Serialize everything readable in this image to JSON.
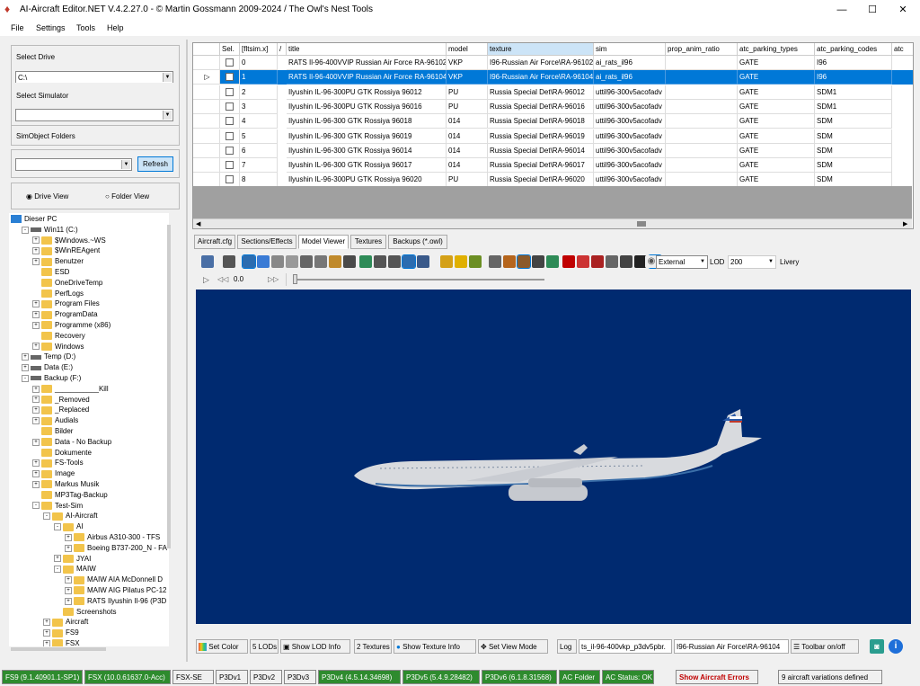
{
  "window": {
    "title": "AI-Aircraft Editor.NET V.4.2.27.0  -  © Martin Gossmann 2009-2024 / The Owl's Nest Tools"
  },
  "menu": [
    "File",
    "Settings",
    "Tools",
    "Help"
  ],
  "left": {
    "select_drive_label": "Select Drive",
    "drive_value": "C:\\",
    "select_sim_label": "Select Simulator",
    "sim_value": "",
    "simobj_label": "SimObject Folders",
    "simobj_value": "",
    "refresh": "Refresh",
    "drive_view": "Drive View",
    "folder_view": "Folder View"
  },
  "tree": [
    {
      "t": "Dieser PC",
      "d": 0,
      "k": "pc"
    },
    {
      "t": "Win11 (C:)",
      "d": 1,
      "k": "drive",
      "pm": "-"
    },
    {
      "t": "$Windows.~WS",
      "d": 2,
      "k": "folder",
      "pm": "+"
    },
    {
      "t": "$WinREAgent",
      "d": 2,
      "k": "folder",
      "pm": "+"
    },
    {
      "t": "Benutzer",
      "d": 2,
      "k": "folder",
      "pm": "+"
    },
    {
      "t": "ESD",
      "d": 2,
      "k": "folder"
    },
    {
      "t": "OneDriveTemp",
      "d": 2,
      "k": "folder"
    },
    {
      "t": "PerfLogs",
      "d": 2,
      "k": "folder"
    },
    {
      "t": "Program Files",
      "d": 2,
      "k": "folder",
      "pm": "+"
    },
    {
      "t": "ProgramData",
      "d": 2,
      "k": "folder",
      "pm": "+"
    },
    {
      "t": "Programme (x86)",
      "d": 2,
      "k": "folder",
      "pm": "+"
    },
    {
      "t": "Recovery",
      "d": 2,
      "k": "folder"
    },
    {
      "t": "Windows",
      "d": 2,
      "k": "folder",
      "pm": "+"
    },
    {
      "t": "Temp (D:)",
      "d": 1,
      "k": "drive",
      "pm": "+"
    },
    {
      "t": "Data (E:)",
      "d": 1,
      "k": "drive",
      "pm": "+"
    },
    {
      "t": "Backup (F:)",
      "d": 1,
      "k": "drive",
      "pm": "-"
    },
    {
      "t": "___________Kill",
      "d": 2,
      "k": "folder",
      "pm": "+"
    },
    {
      "t": "_Removed",
      "d": 2,
      "k": "folder",
      "pm": "+"
    },
    {
      "t": "_Replaced",
      "d": 2,
      "k": "folder",
      "pm": "+"
    },
    {
      "t": "Audials",
      "d": 2,
      "k": "folder",
      "pm": "+"
    },
    {
      "t": "Bilder",
      "d": 2,
      "k": "folder"
    },
    {
      "t": "Data - No Backup",
      "d": 2,
      "k": "folder",
      "pm": "+"
    },
    {
      "t": "Dokumente",
      "d": 2,
      "k": "folder"
    },
    {
      "t": "FS-Tools",
      "d": 2,
      "k": "folder",
      "pm": "+"
    },
    {
      "t": "Image",
      "d": 2,
      "k": "folder",
      "pm": "+"
    },
    {
      "t": "Markus Musik",
      "d": 2,
      "k": "folder",
      "pm": "+"
    },
    {
      "t": "MP3Tag-Backup",
      "d": 2,
      "k": "folder"
    },
    {
      "t": "Test-Sim",
      "d": 2,
      "k": "folder",
      "pm": "-"
    },
    {
      "t": "AI-Aircraft",
      "d": 3,
      "k": "folder",
      "pm": "-"
    },
    {
      "t": "AI",
      "d": 4,
      "k": "folder",
      "pm": "-"
    },
    {
      "t": "Airbus A310-300 - TFS",
      "d": 5,
      "k": "folder",
      "pm": "+"
    },
    {
      "t": "Boeing B737-200_N - FA",
      "d": 5,
      "k": "folder",
      "pm": "+"
    },
    {
      "t": "JYAI",
      "d": 4,
      "k": "folder",
      "pm": "+"
    },
    {
      "t": "MAIW",
      "d": 4,
      "k": "folder",
      "pm": "-"
    },
    {
      "t": "MAIW AIA McDonnell D",
      "d": 5,
      "k": "folder",
      "pm": "+"
    },
    {
      "t": "MAIW AIG Pilatus PC-12",
      "d": 5,
      "k": "folder",
      "pm": "+"
    },
    {
      "t": "RATS Ilyushin Il-96 (P3D",
      "d": 5,
      "k": "folder",
      "pm": "+"
    },
    {
      "t": "Screenshots",
      "d": 4,
      "k": "folder"
    },
    {
      "t": "Aircraft",
      "d": 3,
      "k": "folder",
      "pm": "+"
    },
    {
      "t": "FS9",
      "d": 3,
      "k": "folder",
      "pm": "+"
    },
    {
      "t": "FSX",
      "d": 3,
      "k": "folder",
      "pm": "+"
    }
  ],
  "grid": {
    "headers": [
      "Sel.",
      "[fltsim.x]",
      "/",
      "title",
      "model",
      "texture",
      "sim",
      "prop_anim_ratio",
      "atc_parking_types",
      "atc_parking_codes",
      "atc"
    ],
    "rows": [
      [
        "0",
        "RATS Il-96-400VVIP Russian Air Force RA-96102",
        "VKP",
        "I96-Russian Air Force\\RA-96102",
        "ai_rats_il96",
        "",
        "GATE",
        "I96"
      ],
      [
        "1",
        "RATS Il-96-400VVIP Russian Air Force RA-96104",
        "VKP",
        "I96-Russian Air Force\\RA-96104",
        "ai_rats_il96",
        "",
        "GATE",
        "I96"
      ],
      [
        "2",
        "Ilyushin IL-96-300PU GTK Rossiya 96012",
        "PU",
        "Russia Special Det\\RA-96012",
        "uttil96-300v5acofadv",
        "",
        "GATE",
        "SDM1"
      ],
      [
        "3",
        "Ilyushin IL-96-300PU GTK Rossiya 96016",
        "PU",
        "Russia Special Det\\RA-96016",
        "uttil96-300v5acofadv",
        "",
        "GATE",
        "SDM1"
      ],
      [
        "4",
        "Ilyushin IL-96-300 GTK Rossiya 96018",
        "014",
        "Russia Special Det\\RA-96018",
        "uttil96-300v5acofadv",
        "",
        "GATE",
        "SDM"
      ],
      [
        "5",
        "Ilyushin IL-96-300 GTK Rossiya 96019",
        "014",
        "Russia Special Det\\RA-96019",
        "uttil96-300v5acofadv",
        "",
        "GATE",
        "SDM"
      ],
      [
        "6",
        "Ilyushin IL-96-300 GTK Rossiya 96014",
        "014",
        "Russia Special Det\\RA-96014",
        "uttil96-300v5acofadv",
        "",
        "GATE",
        "SDM"
      ],
      [
        "7",
        "Ilyushin IL-96-300 GTK Rossiya 96017",
        "014",
        "Russia Special Det\\RA-96017",
        "uttil96-300v5acofadv",
        "",
        "GATE",
        "SDM"
      ],
      [
        "8",
        "Ilyushin IL-96-300PU GTK Rossiya 96020",
        "PU",
        "Russia Special Det\\RA-96020",
        "uttil96-300v5acofadv",
        "",
        "GATE",
        "SDM"
      ]
    ],
    "selected_row": 1
  },
  "tabs": [
    "Aircraft.cfg",
    "Sections/Effects",
    "Model Viewer",
    "Textures",
    "Backups (*.owl)"
  ],
  "active_tab": 2,
  "viewer": {
    "view_mode": "External",
    "lod_label": "LOD",
    "lod_value": "200",
    "livery": "Livery",
    "time": "0.0"
  },
  "bottom": {
    "set_color": "Set Color",
    "lods": "5 LODs",
    "show_lod": "Show LOD Info",
    "textures": "2 Textures",
    "show_tex": "Show Texture Info",
    "set_view": "Set View Mode",
    "log": "Log",
    "model_file": "ts_il-96-400vkp_p3dv5pbr.",
    "texture_path": "I96-Russian Air Force\\RA-96104",
    "toolbar_toggle": "Toolbar on/off"
  },
  "status": [
    {
      "t": "FS9 (9.1.40901.1-SP1)",
      "g": true
    },
    {
      "t": "FSX (10.0.61637.0-Acc)",
      "g": true
    },
    {
      "t": "FSX-SE",
      "g": false
    },
    {
      "t": "P3Dv1",
      "g": false
    },
    {
      "t": "P3Dv2",
      "g": false
    },
    {
      "t": "P3Dv3",
      "g": false
    },
    {
      "t": "P3Dv4 (4.5.14.34698)",
      "g": true
    },
    {
      "t": "P3Dv5 (5.4.9.28482)",
      "g": true
    },
    {
      "t": "P3Dv6 (6.1.8.31568)",
      "g": true
    },
    {
      "t": "AC Folder",
      "g": true
    },
    {
      "t": "AC Status: OK",
      "g": true
    }
  ],
  "status_errors": "Show Aircraft Errors",
  "status_count": "9 aircraft variations defined",
  "colors": {
    "selection": "#0078d7",
    "viewport": "#002a70",
    "status_green": "#2e8b2e",
    "error_red": "#c00000"
  },
  "icons": [
    "app-owl-icon",
    "minimize-icon",
    "maximize-icon",
    "close-icon"
  ]
}
